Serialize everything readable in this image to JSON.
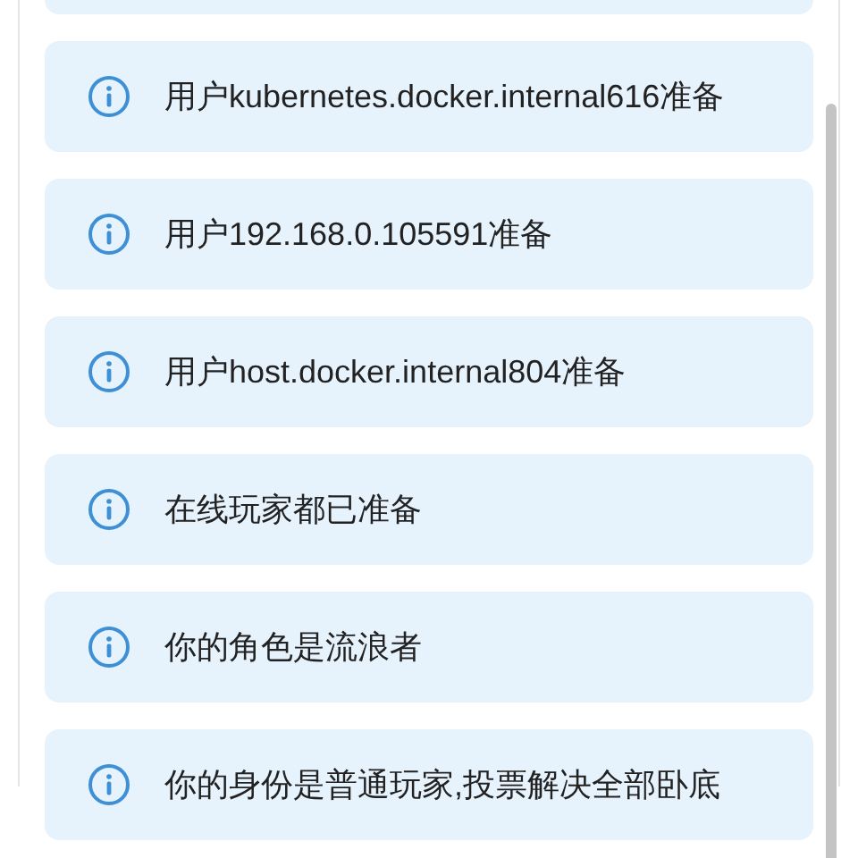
{
  "messages": [
    {
      "kind": "partial"
    },
    {
      "kind": "info",
      "text": "用户kubernetes.docker.internal616准备"
    },
    {
      "kind": "info",
      "text": "用户192.168.0.105591准备"
    },
    {
      "kind": "info",
      "text": "用户host.docker.internal804准备"
    },
    {
      "kind": "info",
      "text": "在线玩家都已准备"
    },
    {
      "kind": "info",
      "text": "你的角色是流浪者"
    },
    {
      "kind": "info",
      "text": "你的身份是普通玩家,投票解决全部卧底"
    }
  ]
}
